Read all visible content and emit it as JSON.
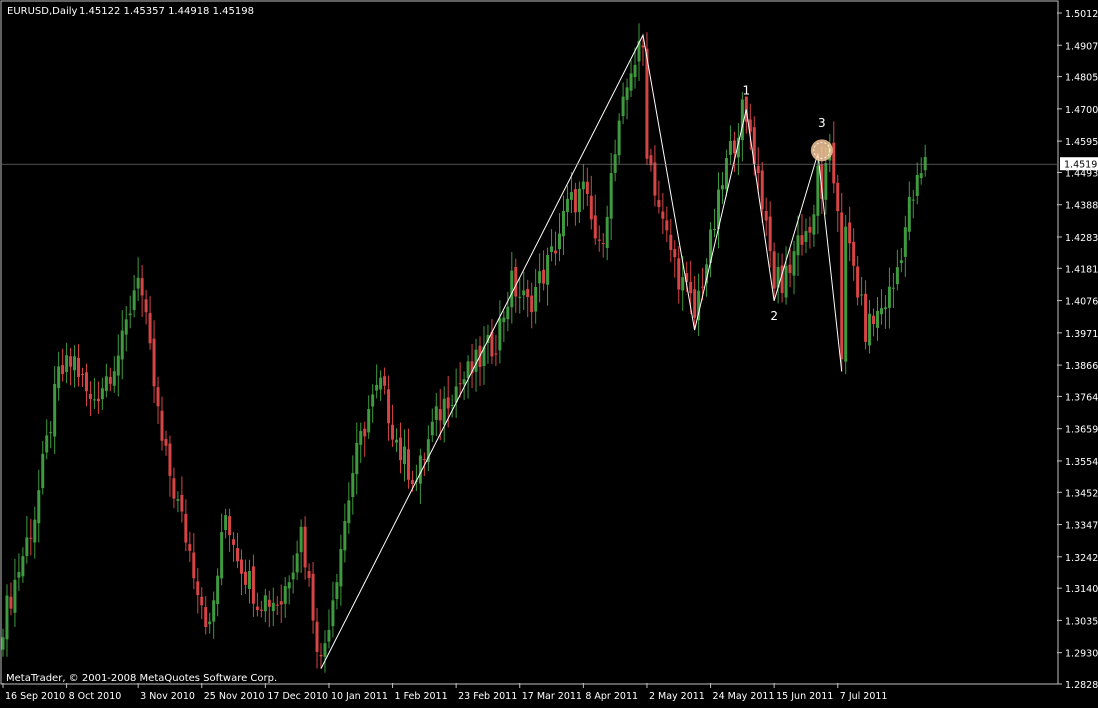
{
  "header": {
    "symbol": "EURUSD,Daily",
    "ohlc": "1.45122 1.45357 1.44918 1.45198"
  },
  "footer": {
    "copyright": "MetaTrader, © 2001-2008 MetaQuotes Software Corp."
  },
  "current_price_label": "1.45198",
  "colors": {
    "background": "#000000",
    "axis": "#c0c0c0",
    "bull": "#3f9a3f",
    "bear": "#d64545",
    "zigzag": "#ffffff",
    "highlight": "#f6c89a"
  },
  "chart_data": {
    "type": "candlestick",
    "title": "",
    "ylim": [
      1.2828,
      1.5012
    ],
    "ytick_values": [
      1.5012,
      1.4907,
      1.4805,
      1.47,
      1.4595,
      1.4493,
      1.4388,
      1.4283,
      1.4181,
      1.4076,
      1.3971,
      1.3866,
      1.3764,
      1.3659,
      1.3554,
      1.3452,
      1.3347,
      1.3242,
      1.314,
      1.3035,
      1.293,
      1.2828
    ],
    "ytick_labels": [
      "1.50120",
      "1.49070",
      "1.48050",
      "1.47000",
      "1.45950",
      "1.44930",
      "1.43880",
      "1.42830",
      "1.41810",
      "1.40760",
      "1.39710",
      "1.38660",
      "1.37640",
      "1.36590",
      "1.35540",
      "1.34520",
      "1.33470",
      "1.32420",
      "1.31400",
      "1.30350",
      "1.29300",
      "1.28280"
    ],
    "xtick_labels": [
      "16 Sep 2010",
      "8 Oct 2010",
      "3 Nov 2010",
      "25 Nov 2010",
      "17 Dec 2010",
      "10 Jan 2011",
      "1 Feb 2011",
      "23 Feb 2011",
      "17 Mar 2011",
      "8 Apr 2011",
      "2 May 2011",
      "24 May 2011",
      "15 Jun 2011",
      "7 Jul 2011"
    ],
    "xtick_bar_index": [
      0,
      16,
      34,
      50,
      66,
      82,
      98,
      114,
      130,
      146,
      162,
      178,
      194,
      210
    ],
    "price_path": [
      [
        0,
        1.303
      ],
      [
        8,
        1.338
      ],
      [
        14,
        1.383
      ],
      [
        18,
        1.388
      ],
      [
        22,
        1.374
      ],
      [
        26,
        1.383
      ],
      [
        30,
        1.393
      ],
      [
        34,
        1.418
      ],
      [
        40,
        1.361
      ],
      [
        47,
        1.326
      ],
      [
        52,
        1.3
      ],
      [
        56,
        1.338
      ],
      [
        60,
        1.322
      ],
      [
        64,
        1.311
      ],
      [
        70,
        1.31
      ],
      [
        75,
        1.333
      ],
      [
        80,
        1.289
      ],
      [
        84,
        1.32
      ],
      [
        88,
        1.352
      ],
      [
        92,
        1.372
      ],
      [
        95,
        1.38
      ],
      [
        100,
        1.358
      ],
      [
        104,
        1.349
      ],
      [
        108,
        1.366
      ],
      [
        112,
        1.377
      ],
      [
        118,
        1.385
      ],
      [
        124,
        1.395
      ],
      [
        128,
        1.413
      ],
      [
        132,
        1.406
      ],
      [
        138,
        1.422
      ],
      [
        142,
        1.438
      ],
      [
        146,
        1.443
      ],
      [
        150,
        1.423
      ],
      [
        154,
        1.455
      ],
      [
        158,
        1.484
      ],
      [
        160,
        1.488
      ],
      [
        162,
        1.458
      ],
      [
        166,
        1.432
      ],
      [
        170,
        1.416
      ],
      [
        174,
        1.404
      ],
      [
        178,
        1.426
      ],
      [
        182,
        1.452
      ],
      [
        186,
        1.469
      ],
      [
        188,
        1.463
      ],
      [
        192,
        1.433
      ],
      [
        196,
        1.412
      ],
      [
        200,
        1.428
      ],
      [
        204,
        1.432
      ],
      [
        208,
        1.454
      ],
      [
        210,
        1.439
      ],
      [
        214,
        1.418
      ],
      [
        217,
        1.398
      ],
      [
        220,
        1.403
      ],
      [
        224,
        1.412
      ],
      [
        228,
        1.438
      ],
      [
        232,
        1.452
      ]
    ],
    "zigzag": [
      {
        "bar": 80,
        "price": 1.2878
      },
      {
        "bar": 161,
        "price": 1.494
      },
      {
        "bar": 174,
        "price": 1.398
      },
      {
        "bar": 187,
        "price": 1.4698
      },
      {
        "bar": 194,
        "price": 1.4075
      },
      {
        "bar": 205,
        "price": 1.4555
      },
      {
        "bar": 211,
        "price": 1.3845
      }
    ],
    "wave_labels": [
      {
        "text": "1",
        "bar": 187,
        "price": 1.4741,
        "anchor": "above"
      },
      {
        "text": "2",
        "bar": 194,
        "price": 1.4075,
        "anchor": "below"
      },
      {
        "text": "3",
        "bar": 206,
        "price": 1.4635,
        "anchor": "above"
      }
    ],
    "highlight_circle": {
      "bar": 206,
      "price": 1.4565
    },
    "current_price": 1.45198
  }
}
